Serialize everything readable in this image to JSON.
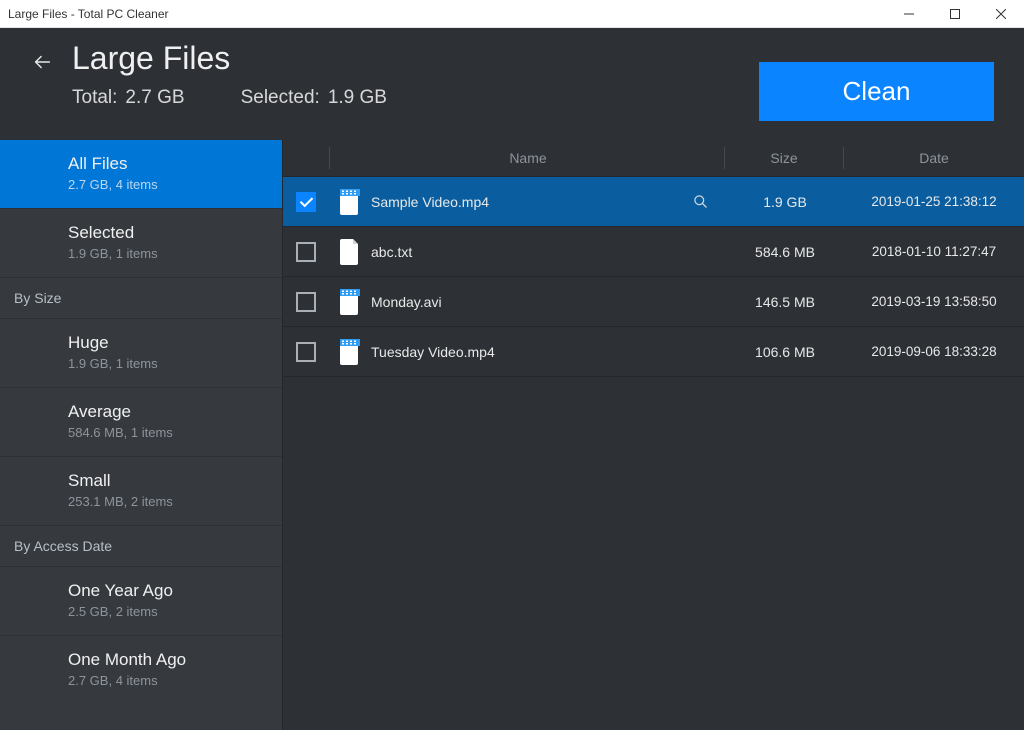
{
  "window": {
    "title": "Large Files - Total PC Cleaner"
  },
  "header": {
    "title": "Large Files",
    "total_label": "Total:",
    "total_value": "2.7 GB",
    "selected_label": "Selected:",
    "selected_value": "1.9 GB",
    "clean_button": "Clean"
  },
  "sidebar": {
    "filters": [
      {
        "label": "All Files",
        "sub": "2.7 GB, 4 items",
        "active": true
      },
      {
        "label": "Selected",
        "sub": "1.9 GB, 1 items",
        "active": false
      }
    ],
    "by_size_header": "By Size",
    "by_size": [
      {
        "label": "Huge",
        "sub": "1.9 GB, 1 items"
      },
      {
        "label": "Average",
        "sub": "584.6 MB, 1 items"
      },
      {
        "label": "Small",
        "sub": "253.1 MB, 2 items"
      }
    ],
    "by_date_header": "By Access Date",
    "by_date": [
      {
        "label": "One Year Ago",
        "sub": "2.5 GB, 2 items"
      },
      {
        "label": "One Month Ago",
        "sub": "2.7 GB, 4 items"
      }
    ]
  },
  "table": {
    "columns": {
      "name": "Name",
      "size": "Size",
      "date": "Date"
    },
    "rows": [
      {
        "checked": true,
        "icon": "video",
        "name": "Sample Video.mp4",
        "size": "1.9 GB",
        "date": "2019-01-25 21:38:12",
        "selected": true
      },
      {
        "checked": false,
        "icon": "text",
        "name": "abc.txt",
        "size": "584.6 MB",
        "date": "2018-01-10 11:27:47",
        "selected": false
      },
      {
        "checked": false,
        "icon": "video",
        "name": "Monday.avi",
        "size": "146.5 MB",
        "date": "2019-03-19 13:58:50",
        "selected": false
      },
      {
        "checked": false,
        "icon": "video",
        "name": "Tuesday Video.mp4",
        "size": "106.6 MB",
        "date": "2019-09-06 18:33:28",
        "selected": false
      }
    ]
  },
  "icons": {
    "video_color": "#2f9ef4",
    "text_color": "#ffffff"
  }
}
